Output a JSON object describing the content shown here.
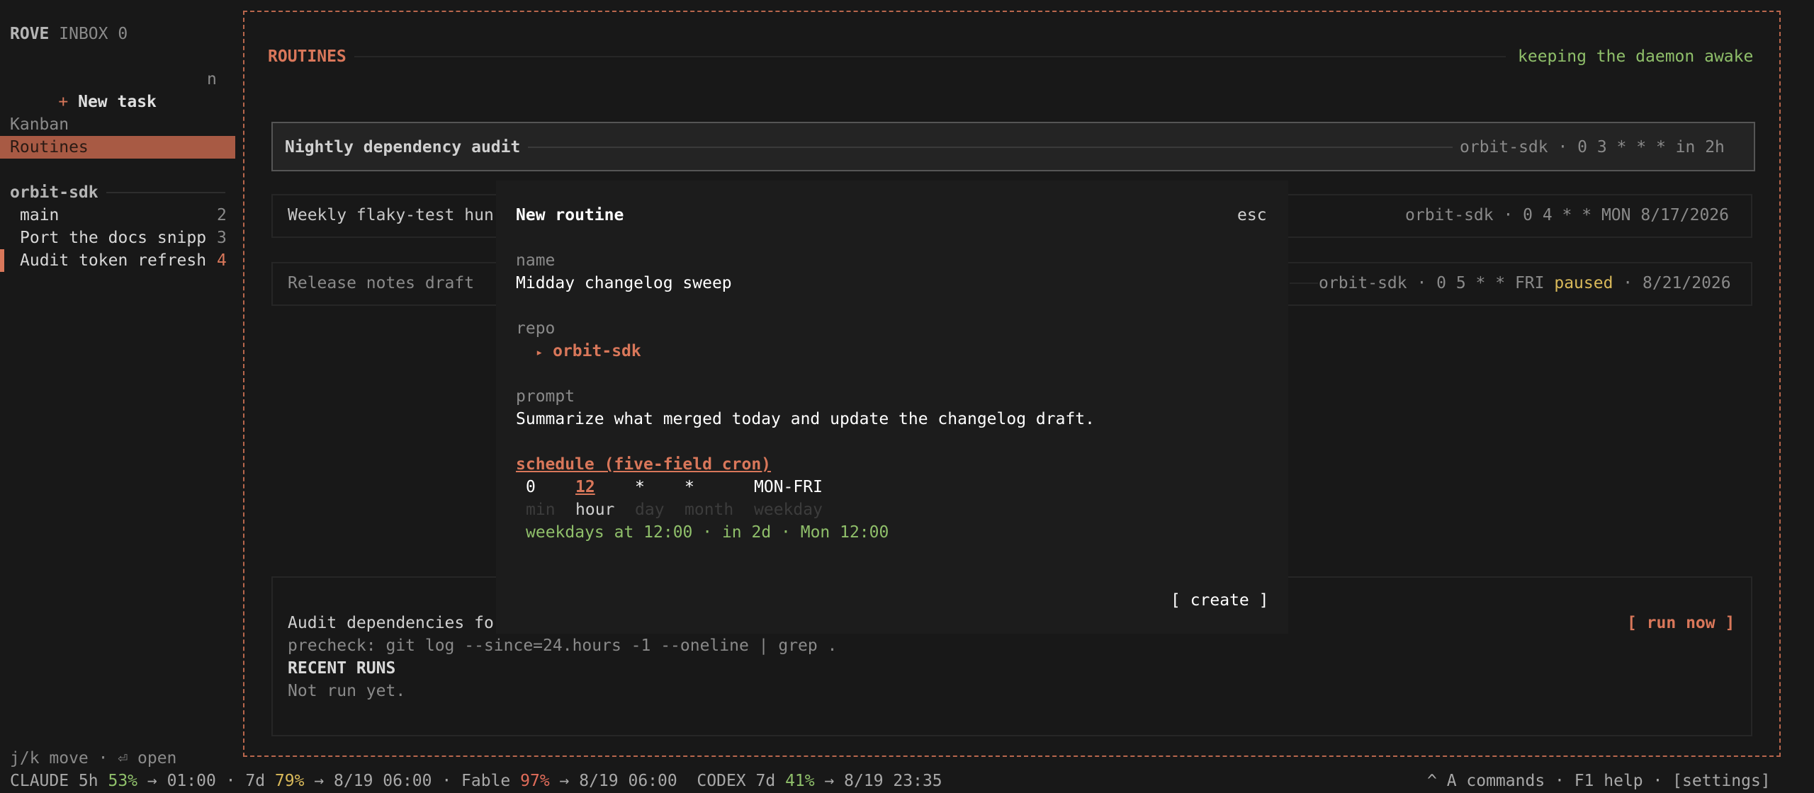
{
  "sidebar": {
    "brand": "ROVE",
    "inbox": "INBOX 0",
    "new_task_plus": "+",
    "new_task_label": "New task",
    "new_task_key": "n",
    "nav": [
      {
        "label": "Kanban",
        "selected": false
      },
      {
        "label": "Routines",
        "selected": true
      }
    ],
    "repo": "orbit-sdk",
    "tasks": [
      {
        "label": "main",
        "count": "2",
        "highlight": false
      },
      {
        "label": "Port the docs snipp",
        "count": "3",
        "highlight": false
      },
      {
        "label": "Audit token refresh",
        "count": "4",
        "highlight": true
      }
    ],
    "hint": "j/k move · ⏎ open"
  },
  "header": {
    "title": "ROUTINES",
    "status": "keeping the daemon awake"
  },
  "routines": [
    {
      "name": "Nightly dependency audit",
      "repo": "orbit-sdk",
      "cron": "0 3 * * *",
      "next": "in 2h",
      "selected": true
    },
    {
      "name": "Weekly flaky-test hun",
      "repo": "orbit-sdk",
      "cron": "0 4 * * MON",
      "next": "8/17/2026",
      "selected": false
    },
    {
      "name": "Release notes draft",
      "repo": "orbit-sdk",
      "cron": "0 5 * * FRI",
      "state": "paused",
      "next": "8/21/2026",
      "selected": false
    }
  ],
  "detail": {
    "summary": "Audit dependencies fo",
    "run_now": "[ run now ]",
    "precheck": "precheck: git log --since=24.hours -1 --oneline | grep .",
    "recent_runs_title": "RECENT RUNS",
    "recent_runs_empty": "Not run yet."
  },
  "modal": {
    "title": "New routine",
    "close_hint": "esc",
    "name_label": "name",
    "name_value": "Midday changelog sweep",
    "repo_label": "repo",
    "repo_marker": "▸",
    "repo_value": "orbit-sdk",
    "prompt_label": "prompt",
    "prompt_value": "Summarize what merged today and update the changelog draft.",
    "schedule_label": "schedule (five-field cron)",
    "cron_fields": [
      {
        "value": "0",
        "label": "min",
        "active": false
      },
      {
        "value": "12",
        "label": "hour",
        "active": true
      },
      {
        "value": "*",
        "label": "day",
        "active": false
      },
      {
        "value": "*",
        "label": "month",
        "active": false
      },
      {
        "value": "MON-FRI",
        "label": "weekday",
        "active": false
      }
    ],
    "schedule_preview": "weekdays at 12:00 · in 2d · Mon 12:00",
    "create_button": "[ create ]"
  },
  "statusbar": {
    "claude_label": "CLAUDE 5h",
    "claude_5h_pct": "53%",
    "claude_5h_reset": "→ 01:00 · 7d",
    "claude_7d_pct": "79%",
    "claude_7d_reset": "→ 8/19 06:00 · Fable",
    "fable_pct": "97%",
    "fable_reset": "→ 8/19 06:00",
    "codex_label": "CODEX 7d",
    "codex_pct": "41%",
    "codex_reset": "→ 8/19 23:35",
    "right": "^ A commands · F1 help · [settings]"
  },
  "colors": {
    "accent": "#d9775a",
    "green": "#8fbf6a",
    "yellow": "#d9b95a",
    "background": "#181818"
  }
}
